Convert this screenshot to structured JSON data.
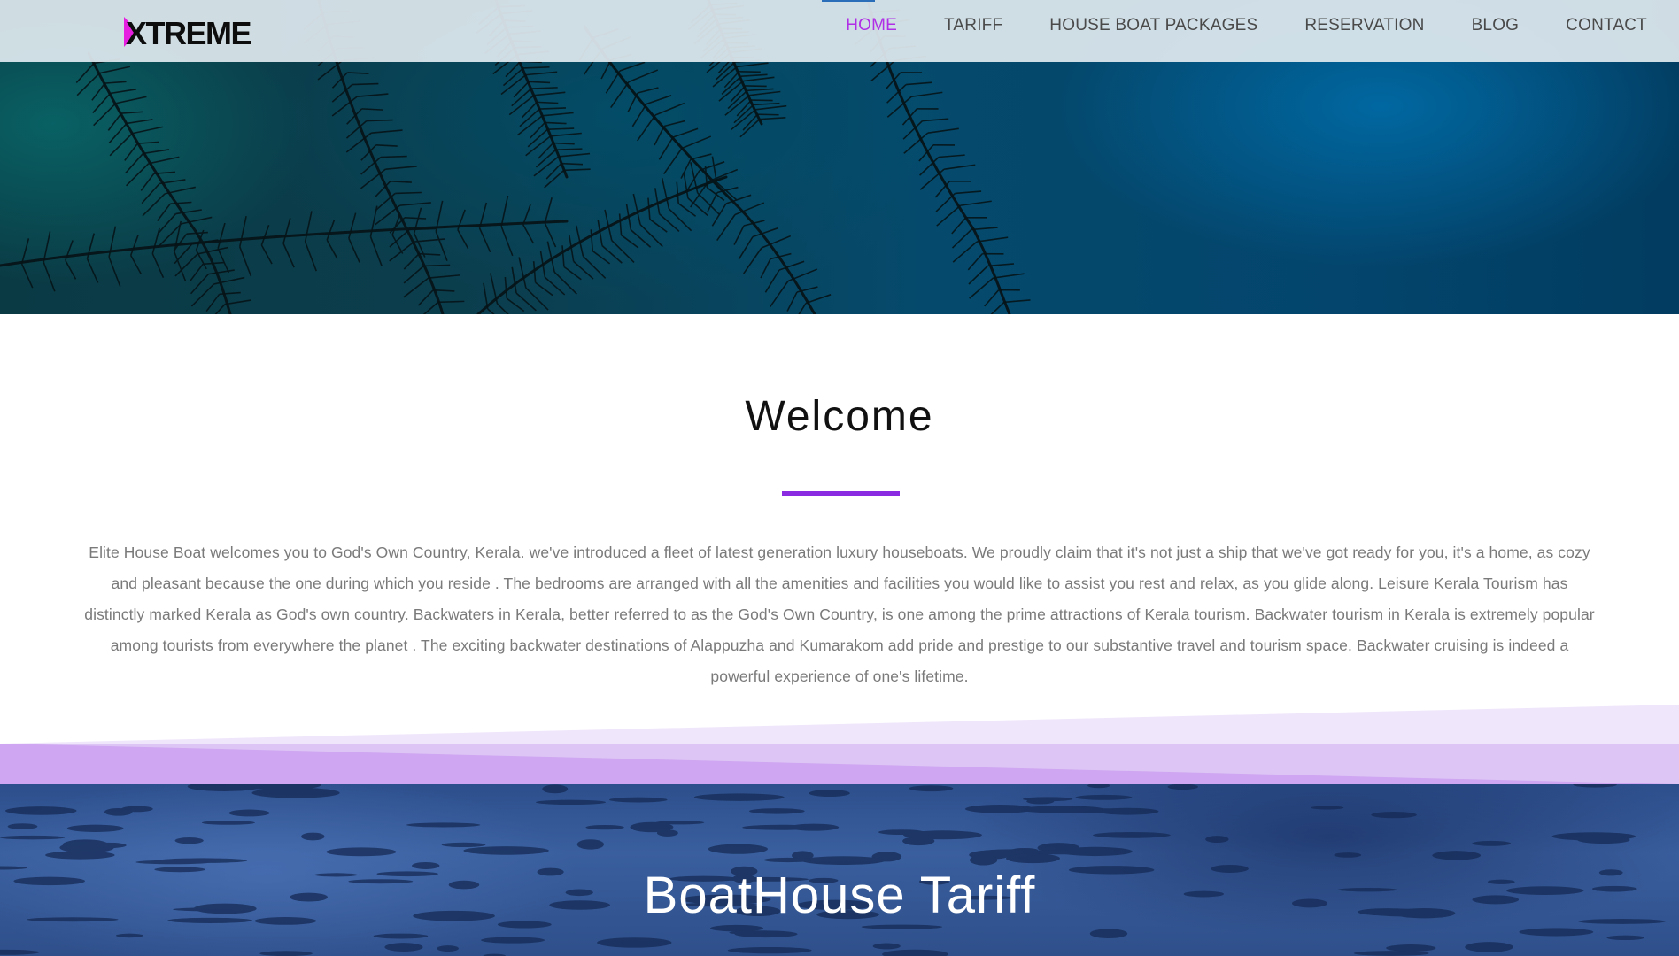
{
  "header": {
    "logo_text": "XTREME",
    "nav": [
      {
        "label": "HOME",
        "active": true
      },
      {
        "label": "TARIFF"
      },
      {
        "label": "HOUSE BOAT PACKAGES"
      },
      {
        "label": "RESERVATION"
      },
      {
        "label": "BLOG"
      },
      {
        "label": "CONTACT"
      }
    ]
  },
  "welcome": {
    "title": "Welcome",
    "body": "Elite House Boat welcomes you to God's Own Country, Kerala. we've introduced a fleet of latest generation luxury houseboats. We proudly claim that it's not just a ship that we've got ready for you, it's a home, as cozy and pleasant because the one during which you reside . The bedrooms are arranged with all the amenities and facilities you would like to assist you rest and relax, as you glide along. Leisure Kerala Tourism has distinctly marked Kerala as God's own country. Backwaters in Kerala, better referred to as the God's Own Country, is one among the prime attractions of Kerala tourism. Backwater tourism in Kerala is extremely popular among tourists from everywhere the planet . The exciting backwater destinations of Alappuzha and Kumarakom add pride and prestige to our substantive travel and tourism space. Backwater cruising is indeed a powerful experience of one's lifetime."
  },
  "tariff": {
    "title": "BoatHouse Tariff"
  },
  "colors": {
    "accent": "#8a2be2",
    "nav_active": "#b02ee6",
    "nav_text": "#4a4a4a",
    "divider_light": "#efe6fb",
    "divider_mid": "#ddc6f5",
    "divider_dark": "#cfa6f1"
  }
}
